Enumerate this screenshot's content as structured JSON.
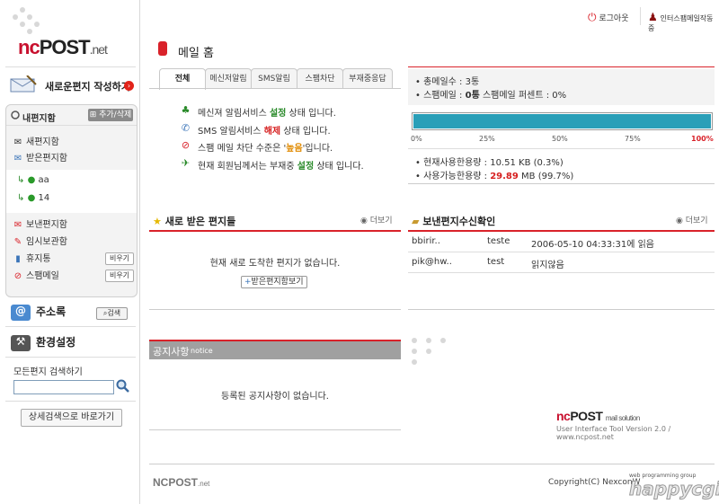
{
  "brand": {
    "nc": "nc",
    "post": "POST",
    "net": ".net"
  },
  "sidebar": {
    "compose_label": "새로운편지 작성하기",
    "mailbox_title": "내편지함",
    "mailbox_add_label": "추가/삭제",
    "folders": [
      {
        "label": "새편지함",
        "icon": "envelope-icon"
      },
      {
        "label": "받은편지함",
        "icon": "inbox-icon"
      }
    ],
    "subfolders": [
      {
        "label": "aa",
        "icon": "user-folder-icon"
      },
      {
        "label": "14",
        "icon": "user-folder-icon"
      }
    ],
    "folders2": [
      {
        "label": "보낸편지함",
        "icon": "sent-icon"
      },
      {
        "label": "임시보관함",
        "icon": "draft-icon"
      },
      {
        "label": "휴지통",
        "icon": "trash-icon",
        "action": "비우기"
      },
      {
        "label": "스팸메일",
        "icon": "spam-icon",
        "action": "비우기"
      }
    ],
    "address_book": "주소록",
    "address_search": "검색",
    "settings": "환경설정",
    "all_search_label": "모든편지 검색하기",
    "detail_search": "상세검색으로 바로가기"
  },
  "header": {
    "logout": "로그아웃",
    "user": "인터스팸메일작동중",
    "page_title": "메일 홈"
  },
  "tabs": [
    "전체",
    "메신저알림",
    "SMS알림",
    "스팸차단",
    "부재중응답"
  ],
  "status": [
    {
      "icon": "messenger-icon",
      "pre": "메신져 알림서비스 ",
      "hl": "설정",
      "hlc": "grn",
      "post": " 상태 입니다."
    },
    {
      "icon": "sms-icon",
      "pre": "SMS 알림서비스 ",
      "hl": "해제",
      "hlc": "red",
      "post": " 상태 입니다."
    },
    {
      "icon": "block-icon",
      "pre": "스팸 메일 차단 수준은 '",
      "hl": "높음",
      "hlc": "org",
      "post": "'입니다."
    },
    {
      "icon": "away-icon",
      "pre": "현재 회원님께서는 부재중 ",
      "hl": "설정",
      "hlc": "grn",
      "post": " 상태 입니다."
    }
  ],
  "summary": {
    "total": "• 총메일수 : 3통",
    "spam_pre": "• 스팸메일 : ",
    "spam_count": "0통",
    "spam_post": " 스팸메일 퍼센트 : 0%"
  },
  "usage": {
    "percent": 0.3,
    "ticks": [
      "0%",
      "25%",
      "50%",
      "75%",
      "100%"
    ],
    "used": "• 현재사용한용량 : 10.51 KB (0.3%)",
    "avail_pre": "• 사용가능한용량 : ",
    "avail_val": "29.89",
    "avail_post": " MB (99.7%)"
  },
  "new_mail": {
    "title": "새로 받은 편지들",
    "more": "더보기",
    "empty": "현재 새로 도착한 편지가 없습니다.",
    "inbox_btn": "받은편지함보기"
  },
  "sent_confirm": {
    "title": "보낸편지수신확인",
    "more": "더보기",
    "rows": [
      {
        "to": "bbirir..",
        "subject": "teste",
        "status": "2006-05-10 04:33:31에 읽음"
      },
      {
        "to": "pik@hw..",
        "subject": "test",
        "status": "읽지않음"
      }
    ]
  },
  "notice": {
    "title": "공지사항",
    "sub": "notice",
    "empty": "등록된 공지사항이 없습니다."
  },
  "promo": {
    "brand_nc": "nc",
    "brand_post": "POST",
    "tag": "mail solution",
    "line": "User Interface Tool Version 2.0 / www.ncpost.net"
  },
  "footer": {
    "brand": "NCPOST",
    "brand_sub": ".net",
    "copyright": "Copyright(C) NexconW",
    "watermark": "happycgi",
    "watermark_sub": "web programming group"
  },
  "colors": {
    "accent": "#d9222a",
    "bar": "#2a9fb8"
  }
}
